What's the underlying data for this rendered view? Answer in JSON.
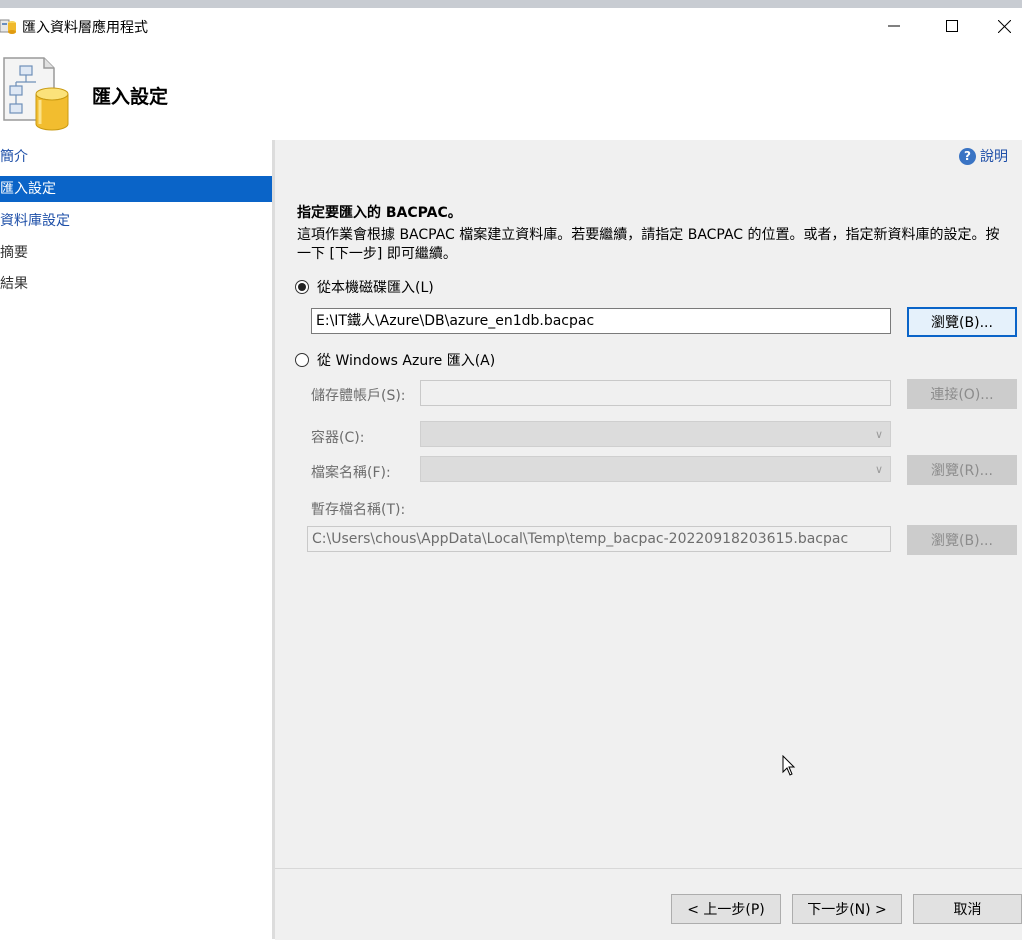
{
  "window": {
    "title": "匯入資料層應用程式"
  },
  "header": {
    "title": "匯入設定"
  },
  "sidebar": {
    "items": [
      {
        "label": "簡介",
        "state": "link"
      },
      {
        "label": "匯入設定",
        "state": "selected"
      },
      {
        "label": "資料庫設定",
        "state": "link"
      },
      {
        "label": "摘要",
        "state": "disabled"
      },
      {
        "label": "結果",
        "state": "disabled"
      }
    ]
  },
  "main": {
    "help_label": "說明",
    "section_title": "指定要匯入的 BACPAC。",
    "description": "這項作業會根據 BACPAC 檔案建立資料庫。若要繼續，請指定 BACPAC 的位置。或者，指定新資料庫的設定。按一下 [下一步] 即可繼續。",
    "local_option": {
      "label": "從本機磁碟匯入(L)",
      "selected": true
    },
    "local_path": "E:\\IT鐵人\\Azure\\DB\\azure_en1db.bacpac",
    "browse_local_label": "瀏覽(B)...",
    "azure_option": {
      "label": "從 Windows Azure 匯入(A)",
      "selected": false
    },
    "storage_account_label": "儲存體帳戶(S):",
    "connect_label": "連接(O)...",
    "container_label": "容器(C):",
    "filename_label": "檔案名稱(F):",
    "browse_file_label": "瀏覽(R)...",
    "temp_filename_label": "暫存檔名稱(T):",
    "temp_path": "C:\\Users\\chous\\AppData\\Local\\Temp\\temp_bacpac-20220918203615.bacpac",
    "browse_temp_label": "瀏覽(B)..."
  },
  "footer": {
    "back_label": "< 上一步(P)",
    "next_label": "下一步(N) >",
    "cancel_label": "取消"
  }
}
